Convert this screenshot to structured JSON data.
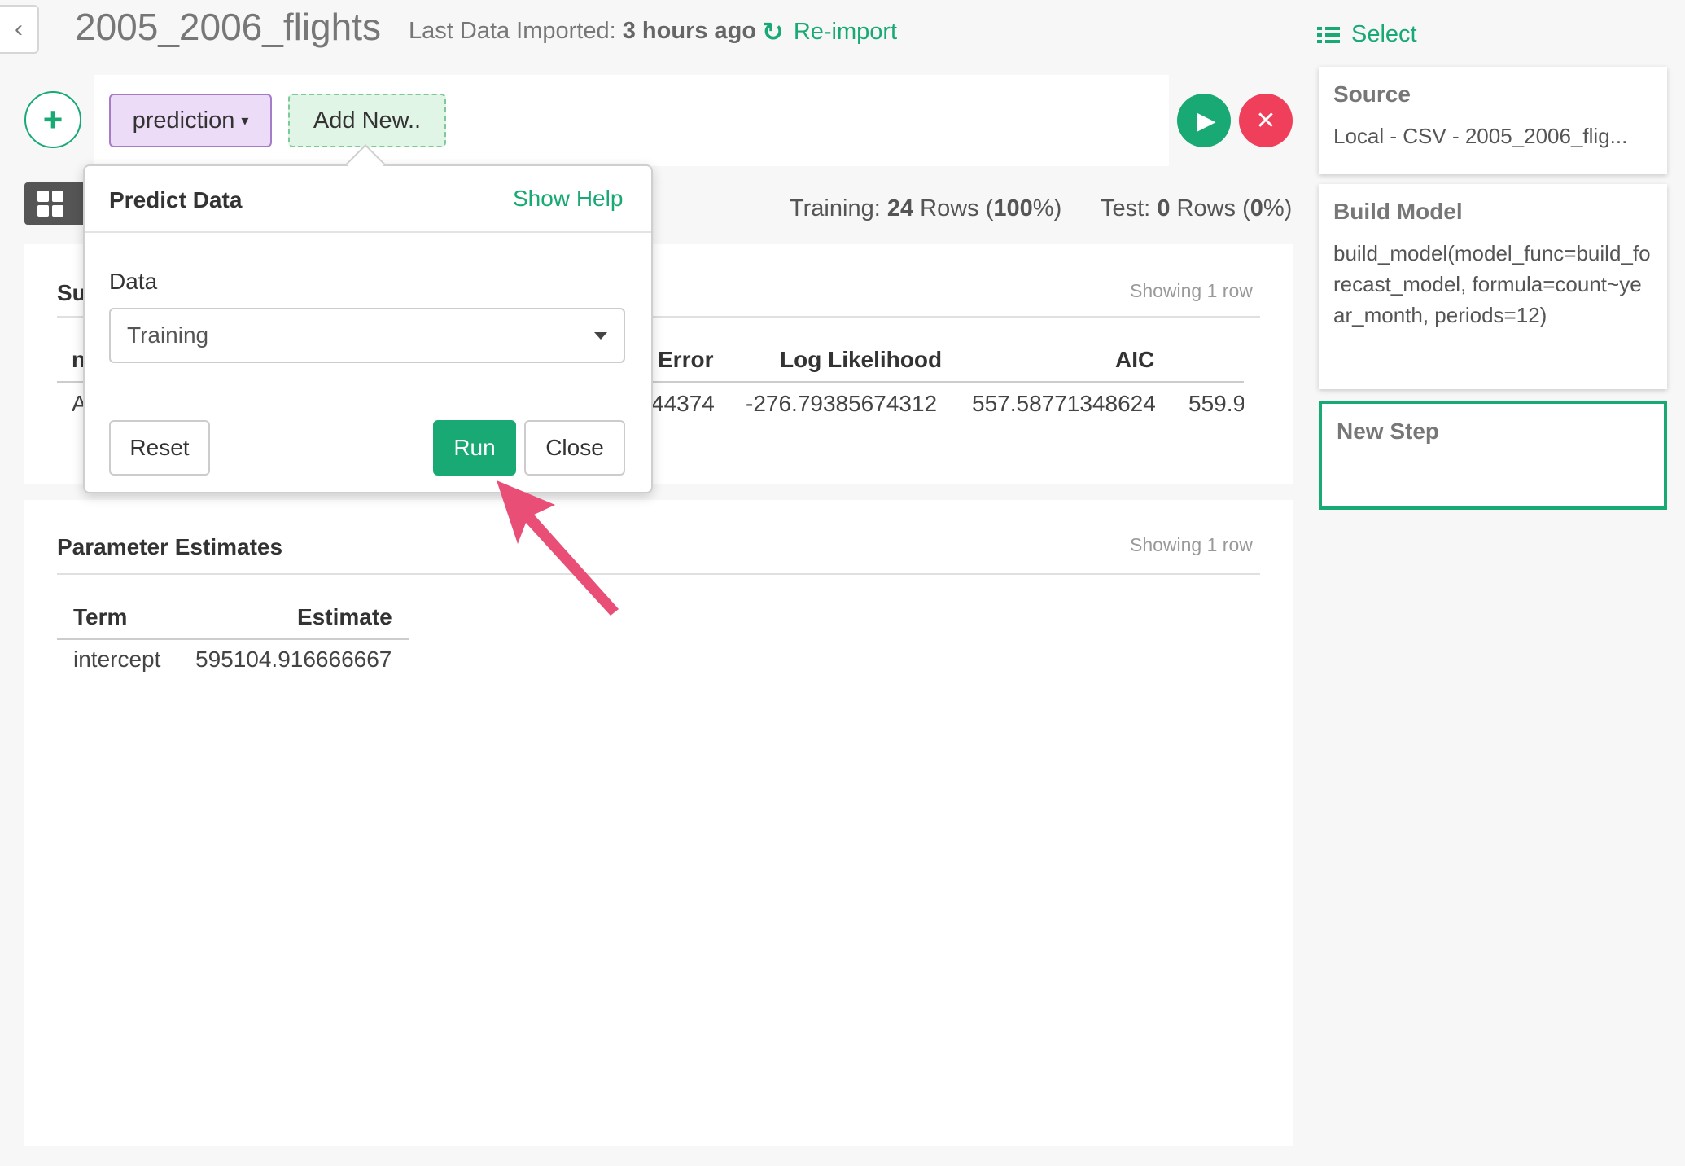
{
  "header": {
    "title": "2005_2006_flights",
    "import_label": "Last Data Imported:",
    "import_time": "3 hours ago",
    "reimport_label": "Re-import"
  },
  "stepbar": {
    "prediction_label": "prediction",
    "addnew_label": "Add New.."
  },
  "summary_toolbar": {
    "training_label": "Training:",
    "training_rows": "24",
    "rows_word": "Rows",
    "training_pct": "100",
    "test_label": "Test:",
    "test_rows": "0",
    "test_pct": "0"
  },
  "summary_card": {
    "title_partial": "Su",
    "showing": "Showing 1 row",
    "header_partial": "n",
    "columns": [
      "Error",
      "Log Likelihood",
      "AIC"
    ],
    "row_partial_first": "A",
    "row": [
      "44374",
      "-276.79385674312",
      "557.58771348624",
      "559.9"
    ]
  },
  "param_card": {
    "title": "Parameter Estimates",
    "showing": "Showing 1 row",
    "columns": [
      "Term",
      "Estimate"
    ],
    "rows": [
      [
        "intercept",
        "595104.916666667"
      ]
    ]
  },
  "right_panel": {
    "select_label": "Select",
    "steps": [
      {
        "title": "Source",
        "body": "Local - CSV - 2005_2006_flig..."
      },
      {
        "title": "Build Model",
        "body": "build_model(model_func=build_forecast_model, formula=count~year_month, periods=12)"
      },
      {
        "title": "New Step",
        "body": ""
      }
    ]
  },
  "popover": {
    "title": "Predict Data",
    "help": "Show Help",
    "data_label": "Data",
    "data_value": "Training",
    "reset": "Reset",
    "run": "Run",
    "close": "Close"
  },
  "colors": {
    "accent": "#19a974",
    "danger": "#ef3f5a",
    "prediction_bg": "#ecdcf7",
    "annotation": "#e94e77"
  }
}
